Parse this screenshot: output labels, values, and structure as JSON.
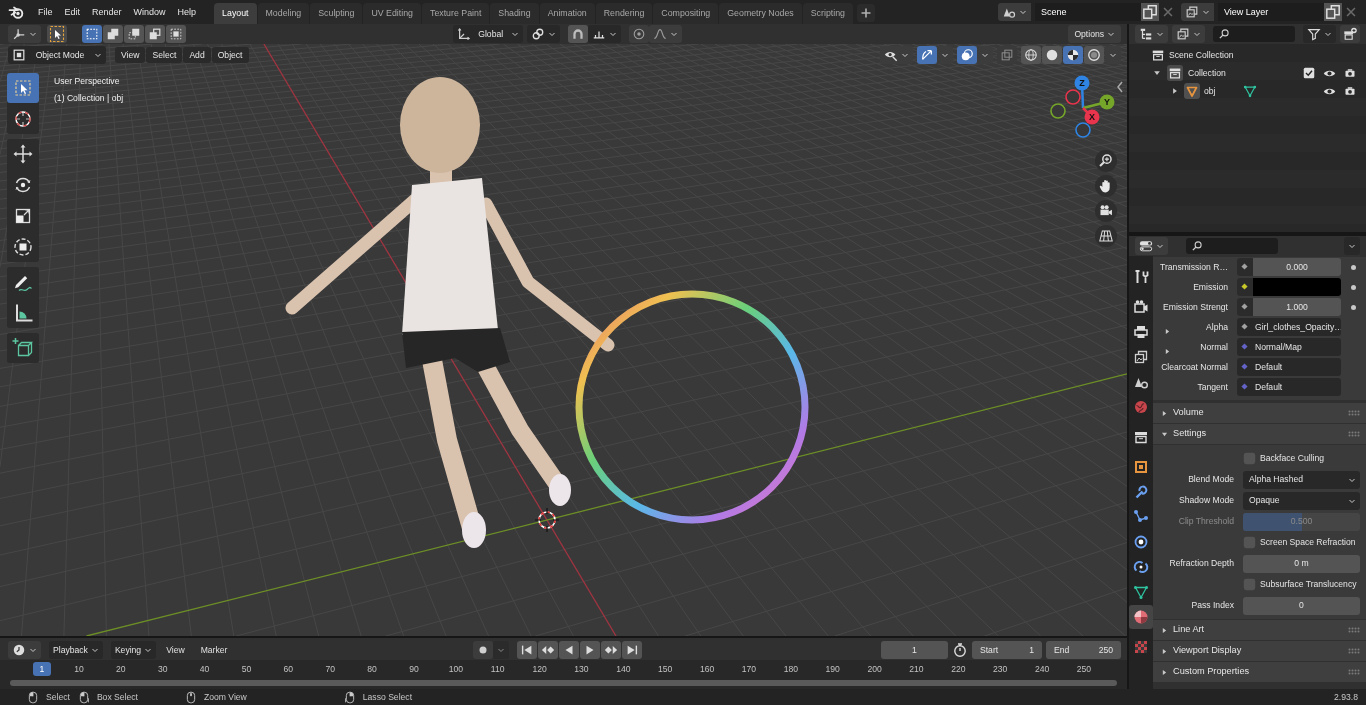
{
  "topbar": {
    "menus": [
      "File",
      "Edit",
      "Render",
      "Window",
      "Help"
    ],
    "workspaces": [
      {
        "label": "Layout",
        "selected": true
      },
      {
        "label": "Modeling",
        "selected": false
      },
      {
        "label": "Sculpting",
        "selected": false
      },
      {
        "label": "UV Editing",
        "selected": false
      },
      {
        "label": "Texture Paint",
        "selected": false
      },
      {
        "label": "Shading",
        "selected": false
      },
      {
        "label": "Animation",
        "selected": false
      },
      {
        "label": "Rendering",
        "selected": false
      },
      {
        "label": "Compositing",
        "selected": false
      },
      {
        "label": "Geometry Nodes",
        "selected": false
      },
      {
        "label": "Scripting",
        "selected": false
      }
    ],
    "scene": "Scene",
    "view_layer": "View Layer"
  },
  "viewport": {
    "tool_header": {
      "select_modes": [
        {
          "kind": "set",
          "selected": true
        },
        {
          "kind": "extend",
          "selected": false
        },
        {
          "kind": "subtract",
          "selected": false
        },
        {
          "kind": "invert",
          "selected": false
        },
        {
          "kind": "intersect",
          "selected": false
        }
      ],
      "transform_orientation": "Global",
      "options": "Options"
    },
    "header": {
      "mode": "Object Mode",
      "menus": [
        "View",
        "Select",
        "Add",
        "Object"
      ],
      "gizmos": true,
      "overlays": true,
      "xray": false,
      "shading": [
        {
          "kind": "wireframe",
          "selected": false
        },
        {
          "kind": "solid",
          "selected": false
        },
        {
          "kind": "material",
          "selected": true
        },
        {
          "kind": "rendered",
          "selected": false
        }
      ]
    },
    "info": [
      "User Perspective",
      "(1) Collection | obj"
    ],
    "tool_groups": [
      [
        {
          "kind": "select-box",
          "selected": true
        },
        {
          "kind": "cursor",
          "selected": false
        }
      ],
      [
        {
          "kind": "move",
          "selected": false
        },
        {
          "kind": "rotate",
          "selected": false
        },
        {
          "kind": "scale",
          "selected": false
        },
        {
          "kind": "transform",
          "selected": false
        }
      ],
      [
        {
          "kind": "annotate",
          "selected": false
        },
        {
          "kind": "measure",
          "selected": false
        }
      ],
      [
        {
          "kind": "add-cube",
          "selected": false
        }
      ]
    ],
    "axes": [
      "Z",
      "Y",
      "X"
    ]
  },
  "outliner": {
    "tree": [
      {
        "kind": "scene-collection",
        "label": "Scene Collection",
        "children": [
          {
            "kind": "collection",
            "label": "Collection",
            "expanded": true,
            "checked": true,
            "children": [
              {
                "kind": "object",
                "label": "obj",
                "expanded": false
              }
            ]
          }
        ]
      }
    ]
  },
  "properties": {
    "tab_groups": [
      [
        {
          "kind": "tool",
          "selected": false
        }
      ],
      [
        {
          "kind": "render",
          "selected": false
        },
        {
          "kind": "output",
          "selected": false
        },
        {
          "kind": "view-layer",
          "selected": false
        },
        {
          "kind": "scene",
          "selected": false
        },
        {
          "kind": "world",
          "selected": false
        }
      ],
      [
        {
          "kind": "collection",
          "selected": false
        }
      ],
      [
        {
          "kind": "object",
          "selected": false
        },
        {
          "kind": "modifier",
          "selected": false
        },
        {
          "kind": "particles",
          "selected": false
        },
        {
          "kind": "physics",
          "selected": false
        },
        {
          "kind": "constraints",
          "selected": false
        },
        {
          "kind": "mesh-data",
          "selected": false
        },
        {
          "kind": "material",
          "selected": true
        }
      ],
      [
        {
          "kind": "texture",
          "selected": false
        }
      ]
    ],
    "inputs": [
      {
        "kind": "value",
        "label": "Transmission R…",
        "value": "0.000",
        "color": "#a1a1a1",
        "decorator": true
      },
      {
        "kind": "color",
        "label": "Emission",
        "color": "#c7c729",
        "decorator": true
      },
      {
        "kind": "value",
        "label": "Emission Strengt",
        "value": "1.000",
        "color": "#a1a1a1",
        "decorator": true
      },
      {
        "kind": "link",
        "label": "Alpha",
        "value": "Girl_clothes_Opacity…",
        "color": "#a1a1a1",
        "decorator": false,
        "expanded": false
      },
      {
        "kind": "link",
        "label": "Normal",
        "value": "Normal/Map",
        "color": "#6363c7",
        "decorator": false,
        "expanded": false
      },
      {
        "kind": "vector",
        "label": "Clearcoat Normal",
        "value": "Default",
        "color": "#6363c7",
        "decorator": false
      },
      {
        "kind": "vector",
        "label": "Tangent",
        "value": "Default",
        "color": "#6363c7",
        "decorator": false
      }
    ],
    "panels": [
      {
        "title": "Volume",
        "expanded": false
      },
      {
        "title": "Settings",
        "expanded": true,
        "rows": [
          {
            "kind": "checkbox",
            "label": "Backface Culling",
            "checked": false,
            "disabled": false
          },
          {
            "kind": "dropdown",
            "label": "Blend Mode",
            "value": "Alpha Hashed",
            "disabled": false
          },
          {
            "kind": "dropdown",
            "label": "Shadow Mode",
            "value": "Opaque",
            "disabled": false
          },
          {
            "kind": "slider",
            "label": "Clip Threshold",
            "value": "0.500",
            "level": 0.5,
            "disabled": true
          },
          {
            "kind": "checkbox",
            "label": "Screen Space Refraction",
            "checked": false,
            "disabled": false
          },
          {
            "kind": "number",
            "label": "Refraction Depth",
            "value": "0 m",
            "disabled": false
          },
          {
            "kind": "checkbox",
            "label": "Subsurface Translucency",
            "checked": false,
            "disabled": false
          },
          {
            "kind": "number",
            "label": "Pass Index",
            "value": "0",
            "disabled": false
          }
        ]
      },
      {
        "title": "Line Art",
        "expanded": false
      },
      {
        "title": "Viewport Display",
        "expanded": false
      },
      {
        "title": "Custom Properties",
        "expanded": false
      }
    ]
  },
  "timeline": {
    "menus": [
      {
        "label": "Playback",
        "dropdown": true
      },
      {
        "label": "Keying",
        "dropdown": true
      },
      {
        "label": "View",
        "dropdown": false
      },
      {
        "label": "Marker",
        "dropdown": false
      }
    ],
    "auto_keying": false,
    "current_frame": "1",
    "start_label": "Start",
    "start": "1",
    "end_label": "End",
    "end": "250",
    "ruler_current": "1",
    "ruler": [
      "10",
      "20",
      "30",
      "40",
      "50",
      "60",
      "70",
      "80",
      "90",
      "100",
      "110",
      "120",
      "130",
      "140",
      "150",
      "160",
      "170",
      "180",
      "190",
      "200",
      "210",
      "220",
      "230",
      "240",
      "250"
    ]
  },
  "statusbar": {
    "hints": [
      {
        "kind": "left-click",
        "label": "Select"
      },
      {
        "kind": "left-drag",
        "label": "Box Select"
      },
      {
        "kind": "middle-click",
        "label": "Zoom View"
      },
      {
        "kind": "right-drag",
        "label": "Lasso Select"
      }
    ],
    "version": "2.93.8"
  }
}
